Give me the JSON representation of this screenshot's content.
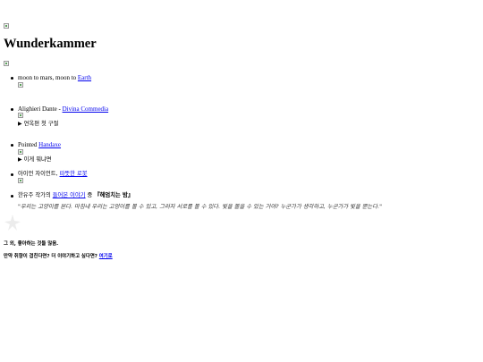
{
  "title": "Wunderkammer",
  "items": [
    {
      "text": "moon to mars, moon to ",
      "link": "Earth"
    },
    {
      "text": "Alighieri Dante - ",
      "link": "Divina Commedia",
      "summary": "연옥편 첫 구절"
    },
    {
      "text": "Pointed ",
      "link": "Handaxe",
      "summary": "이게 뭐냐면"
    },
    {
      "text": "아이언 자이언트, ",
      "link": "따뜻한 로봇"
    },
    {
      "text_before": "한유주 작가의 ",
      "link": "들어본 이야기",
      "text_middle": " 중 ",
      "bold_title": "『헤엄치는 밤』",
      "quote": "\"우리는 고양이를 본다. 마침내 우리는 고양이를 볼 수 있고, 그러자 서로를 볼 수 있다. 빛을 볼을 수 있는 거야? 누군가가 생각하고, 누군가가 빛을 뿐는다.\""
    }
  ],
  "footer": {
    "line1": "그 외, 좋아하는 것들 많음.",
    "line2_text": "만약 취향이 겹친다면? 더 이야기하고 싶다면? ",
    "line2_link": "여기로"
  }
}
